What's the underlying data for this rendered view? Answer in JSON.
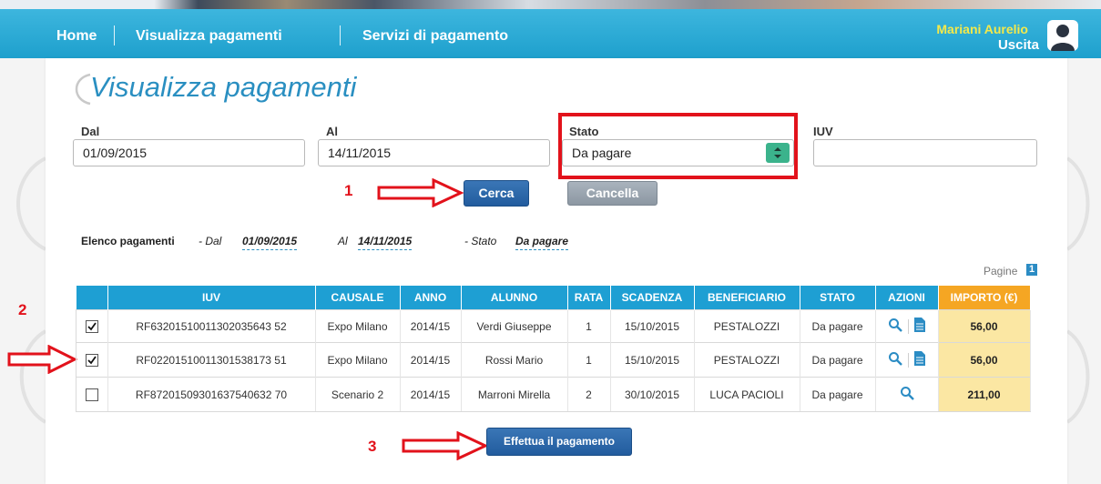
{
  "header": {
    "nav": [
      "Home",
      "Visualizza pagamenti",
      "Servizi di pagamento"
    ],
    "user_name": "Mariani Aurelio",
    "logout": "Uscita"
  },
  "page": {
    "title": "Visualizza pagamenti"
  },
  "filters": {
    "dal_label": "Dal",
    "dal_value": "01/09/2015",
    "al_label": "Al",
    "al_value": "14/11/2015",
    "stato_label": "Stato",
    "stato_value": "Da pagare",
    "iuv_label": "IUV",
    "iuv_value": ""
  },
  "buttons": {
    "search": "Cerca",
    "cancel": "Cancella",
    "pay": "Effettua il pagamento"
  },
  "steps": [
    "1",
    "2",
    "3"
  ],
  "summary": {
    "title": "Elenco pagamenti",
    "dal_label": "- Dal",
    "dal_value": "01/09/2015",
    "al_label": "Al",
    "al_value": "14/11/2015",
    "stato_label": "- Stato",
    "stato_value": "Da pagare"
  },
  "pagination": {
    "label": "Pagine",
    "current": "1"
  },
  "table": {
    "headers": [
      "",
      "IUV",
      "CAUSALE",
      "ANNO",
      "ALUNNO",
      "RATA",
      "SCADENZA",
      "BENEFICIARIO",
      "STATO",
      "AZIONI",
      "IMPORTO (€)"
    ],
    "rows": [
      {
        "checked": true,
        "iuv": "RF63201510011302035643 52",
        "causale": "Expo Milano",
        "anno": "2014/15",
        "alunno": "Verdi Giuseppe",
        "rata": "1",
        "scadenza": "15/10/2015",
        "beneficiario": "PESTALOZZI",
        "stato": "Da pagare",
        "importo": "56,00"
      },
      {
        "checked": true,
        "iuv": "RF02201510011301538173 51",
        "causale": "Expo Milano",
        "anno": "2014/15",
        "alunno": "Rossi Mario",
        "rata": "1",
        "scadenza": "15/10/2015",
        "beneficiario": "PESTALOZZI",
        "stato": "Da pagare",
        "importo": "56,00"
      },
      {
        "checked": false,
        "iuv": "RF87201509301637540632 70",
        "causale": "Scenario 2",
        "anno": "2014/15",
        "alunno": "Marroni Mirella",
        "rata": "2",
        "scadenza": "30/10/2015",
        "beneficiario": "LUCA PACIOLI",
        "stato": "Da pagare",
        "importo": "211,00"
      }
    ]
  },
  "colors": {
    "nav_blue": "#1ea0cd",
    "title_blue": "#2a8fc1",
    "header_blue": "#1e9fd3",
    "importo_orange": "#f5a623",
    "importo_cell": "#fbe7a3",
    "annotation_red": "#e2121b",
    "user_yellow": "#f4e94a"
  },
  "icons": [
    "user-avatar-icon",
    "select-arrows-icon",
    "magnifier-icon",
    "document-icon",
    "checkbox-checked-icon",
    "right-arrow-icon"
  ]
}
